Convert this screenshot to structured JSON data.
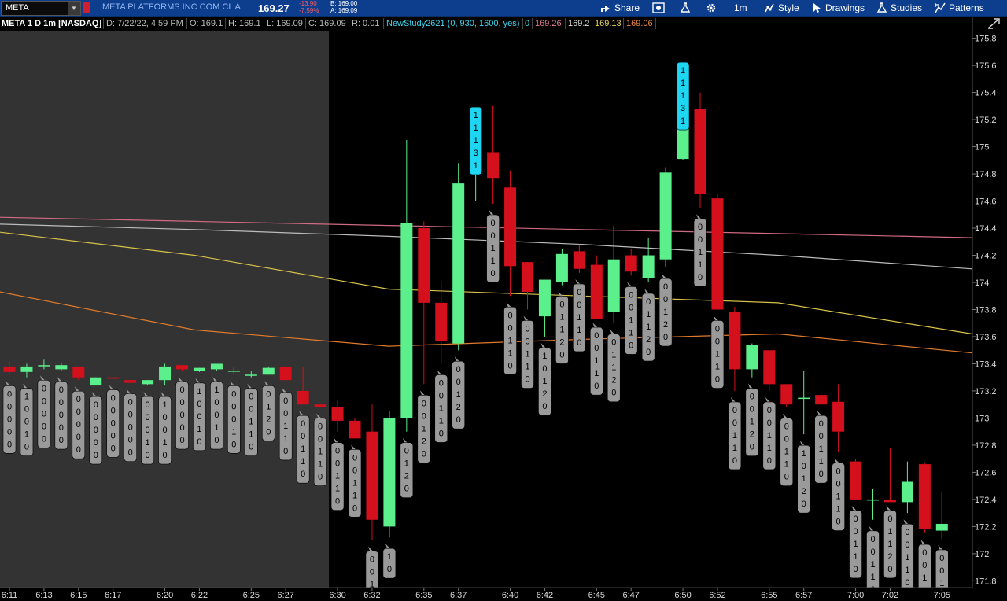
{
  "toolbar": {
    "symbol": "META",
    "company": "META PLATFORMS INC COM CL A",
    "last": "169.27",
    "change": "-13.90",
    "change_pct": "-7.59%",
    "bid": "B: 169.00",
    "ask": "A: 169.09",
    "share_label": "Share",
    "timeframe_label": "1m",
    "style_label": "Style",
    "drawings_label": "Drawings",
    "studies_label": "Studies",
    "patterns_label": "Patterns"
  },
  "infobar": {
    "title": "META 1 D 1m [NASDAQ]",
    "date": "D: 7/22/22, 4:59 PM",
    "open": "O: 169.1",
    "high": "H: 169.1",
    "low": "L: 169.09",
    "close": "C: 169.09",
    "range": "R: 0.01",
    "study": "NewStudy2621 (0, 930, 1600, yes)",
    "study_value": "0",
    "ma1": "169.26",
    "ma2": "169.2",
    "ma3": "169.13",
    "ma4": "169.06"
  },
  "colors": {
    "up": "#5cf08c",
    "down": "#d4101c",
    "extended_bg": "#333333",
    "label_grey": "#9a9a9a",
    "label_cyan": "#1ed6f2",
    "ma_pink": "#d06a82",
    "ma_white": "#bcbcbc",
    "ma_yellow": "#d8c34a",
    "ma_orange": "#e07a2c"
  },
  "chart_data": {
    "type": "candlestick",
    "ylim": [
      171.75,
      175.85
    ],
    "y_ticks": [
      "175.8",
      "175.6",
      "175.4",
      "175.2",
      "175",
      "174.8",
      "174.6",
      "174.4",
      "174.2",
      "174",
      "173.8",
      "173.6",
      "173.4",
      "173.2",
      "173",
      "172.8",
      "172.6",
      "172.4",
      "172.2",
      "172",
      "171.8"
    ],
    "x_ticks": [
      "6:11",
      "6:13",
      "6:15",
      "6:17",
      "6:20",
      "6:22",
      "6:25",
      "6:27",
      "6:30",
      "6:32",
      "6:35",
      "6:37",
      "6:40",
      "6:42",
      "6:45",
      "6:47",
      "6:50",
      "6:52",
      "6:55",
      "6:57",
      "7:00",
      "7:02",
      "7:05"
    ],
    "candles": [
      {
        "o": 173.38,
        "h": 173.42,
        "l": 173.32,
        "c": 173.34
      },
      {
        "o": 173.34,
        "h": 173.4,
        "l": 173.3,
        "c": 173.38
      },
      {
        "o": 173.39,
        "h": 173.43,
        "l": 173.36,
        "c": 173.39
      },
      {
        "o": 173.36,
        "h": 173.41,
        "l": 173.35,
        "c": 173.39
      },
      {
        "o": 173.38,
        "h": 173.38,
        "l": 173.28,
        "c": 173.3
      },
      {
        "o": 173.24,
        "h": 173.3,
        "l": 173.24,
        "c": 173.3
      },
      {
        "o": 173.3,
        "h": 173.3,
        "l": 173.29,
        "c": 173.29
      },
      {
        "o": 173.28,
        "h": 173.28,
        "l": 173.26,
        "c": 173.26
      },
      {
        "o": 173.25,
        "h": 173.28,
        "l": 173.24,
        "c": 173.28
      },
      {
        "o": 173.28,
        "h": 173.4,
        "l": 173.24,
        "c": 173.38
      },
      {
        "o": 173.39,
        "h": 173.39,
        "l": 173.35,
        "c": 173.36
      },
      {
        "o": 173.35,
        "h": 173.37,
        "l": 173.34,
        "c": 173.37
      },
      {
        "o": 173.36,
        "h": 173.4,
        "l": 173.35,
        "c": 173.4
      },
      {
        "o": 173.35,
        "h": 173.38,
        "l": 173.32,
        "c": 173.35
      },
      {
        "o": 173.32,
        "h": 173.35,
        "l": 173.3,
        "c": 173.32
      },
      {
        "o": 173.32,
        "h": 173.38,
        "l": 173.32,
        "c": 173.37
      },
      {
        "o": 173.38,
        "h": 173.38,
        "l": 173.27,
        "c": 173.28
      },
      {
        "o": 173.2,
        "h": 173.38,
        "l": 173.1,
        "c": 173.1
      },
      {
        "o": 173.1,
        "h": 173.1,
        "l": 173.08,
        "c": 173.08
      },
      {
        "o": 173.08,
        "h": 173.13,
        "l": 172.9,
        "c": 172.98
      },
      {
        "o": 172.98,
        "h": 173.0,
        "l": 172.85,
        "c": 172.85
      },
      {
        "o": 172.9,
        "h": 173.1,
        "l": 172.1,
        "c": 172.25
      },
      {
        "o": 172.2,
        "h": 173.05,
        "l": 172.12,
        "c": 173.0
      },
      {
        "o": 173.0,
        "h": 175.05,
        "l": 172.9,
        "c": 174.44
      },
      {
        "o": 174.4,
        "h": 174.45,
        "l": 173.25,
        "c": 173.85
      },
      {
        "o": 173.85,
        "h": 174.0,
        "l": 173.4,
        "c": 173.57
      },
      {
        "o": 173.55,
        "h": 174.88,
        "l": 173.5,
        "c": 174.73
      },
      {
        "o": 174.8,
        "h": 175.27,
        "l": 174.6,
        "c": 174.95
      },
      {
        "o": 174.96,
        "h": 175.3,
        "l": 174.58,
        "c": 174.77
      },
      {
        "o": 174.7,
        "h": 174.82,
        "l": 173.9,
        "c": 174.12
      },
      {
        "o": 174.15,
        "h": 174.15,
        "l": 173.8,
        "c": 173.93
      },
      {
        "o": 173.75,
        "h": 174.02,
        "l": 173.6,
        "c": 174.02
      },
      {
        "o": 174.0,
        "h": 174.25,
        "l": 173.98,
        "c": 174.21
      },
      {
        "o": 174.23,
        "h": 174.28,
        "l": 174.07,
        "c": 174.1
      },
      {
        "o": 174.13,
        "h": 174.2,
        "l": 173.75,
        "c": 173.73
      },
      {
        "o": 173.78,
        "h": 174.42,
        "l": 173.7,
        "c": 174.17
      },
      {
        "o": 174.2,
        "h": 174.25,
        "l": 174.05,
        "c": 174.08
      },
      {
        "o": 174.03,
        "h": 174.33,
        "l": 174.0,
        "c": 174.2
      },
      {
        "o": 174.17,
        "h": 174.85,
        "l": 174.11,
        "c": 174.81
      },
      {
        "o": 174.91,
        "h": 175.6,
        "l": 174.9,
        "c": 175.22
      },
      {
        "o": 175.28,
        "h": 175.4,
        "l": 174.55,
        "c": 174.65
      },
      {
        "o": 174.62,
        "h": 174.65,
        "l": 173.8,
        "c": 173.8
      },
      {
        "o": 173.78,
        "h": 173.82,
        "l": 173.2,
        "c": 173.36
      },
      {
        "o": 173.36,
        "h": 173.55,
        "l": 173.3,
        "c": 173.54
      },
      {
        "o": 173.5,
        "h": 173.5,
        "l": 173.2,
        "c": 173.25
      },
      {
        "o": 173.25,
        "h": 173.25,
        "l": 173.08,
        "c": 173.1
      },
      {
        "o": 173.15,
        "h": 173.35,
        "l": 172.88,
        "c": 173.15
      },
      {
        "o": 173.17,
        "h": 173.2,
        "l": 173.1,
        "c": 173.1
      },
      {
        "o": 173.12,
        "h": 173.25,
        "l": 172.75,
        "c": 172.9
      },
      {
        "o": 172.68,
        "h": 172.7,
        "l": 172.4,
        "c": 172.4
      },
      {
        "o": 172.4,
        "h": 172.48,
        "l": 172.25,
        "c": 172.4
      },
      {
        "o": 172.4,
        "h": 172.78,
        "l": 172.4,
        "c": 172.38
      },
      {
        "o": 172.38,
        "h": 172.68,
        "l": 172.3,
        "c": 172.53
      },
      {
        "o": 172.66,
        "h": 172.67,
        "l": 172.15,
        "c": 172.18
      },
      {
        "o": 172.17,
        "h": 172.45,
        "l": 172.11,
        "c": 172.22
      }
    ],
    "labels": [
      [
        "0",
        "0",
        "0",
        "0",
        "0"
      ],
      [
        "1",
        "0",
        "0",
        "1",
        "0"
      ],
      [
        "0",
        "0",
        "0",
        "0",
        "0"
      ],
      [
        "0",
        "0",
        "0",
        "0",
        "0"
      ],
      [
        "0",
        "0",
        "0",
        "0",
        "0"
      ],
      [
        "0",
        "0",
        "0",
        "0",
        "0"
      ],
      [
        "0",
        "0",
        "0",
        "0",
        "0"
      ],
      [
        "0",
        "0",
        "0",
        "0",
        "0"
      ],
      [
        "0",
        "0",
        "0",
        "1",
        "0"
      ],
      [
        "1",
        "0",
        "0",
        "1",
        "0"
      ],
      [
        "0",
        "0",
        "0",
        "0",
        "0"
      ],
      [
        "1",
        "0",
        "0",
        "1",
        "0"
      ],
      [
        "1",
        "0",
        "0",
        "1",
        "0"
      ],
      [
        "0",
        "0",
        "0",
        "1",
        "0"
      ],
      [
        "0",
        "0",
        "1",
        "1",
        "0"
      ],
      [
        "0",
        "1",
        "2",
        "0",
        ""
      ],
      [
        "0",
        "0",
        "1",
        "1",
        "0"
      ],
      [
        "0",
        "0",
        "1",
        "1",
        "0"
      ],
      [
        "0",
        "0",
        "1",
        "1",
        "0"
      ],
      [
        "0",
        "0",
        "1",
        "1",
        "0"
      ],
      [
        "0",
        "0",
        "1",
        "1",
        "0"
      ],
      [
        "0",
        "0",
        "1",
        ""
      ],
      [
        "1",
        "0",
        ""
      ],
      [
        "0",
        "1",
        "2",
        "0"
      ],
      [
        "0",
        "0",
        "1",
        "2",
        "0"
      ],
      [
        "0",
        "0",
        "1",
        "1",
        "0"
      ],
      [
        "0",
        "0",
        "1",
        "2",
        "0"
      ],
      [
        "1",
        "1",
        "1",
        "3",
        "1"
      ],
      [
        "0",
        "0",
        "1",
        "1",
        "0"
      ],
      [
        "0",
        "0",
        "1",
        "1",
        "0"
      ],
      [
        "0",
        "0",
        "1",
        "1",
        "0"
      ],
      [
        "1",
        "0",
        "1",
        "2",
        "0"
      ],
      [
        "0",
        "1",
        "1",
        "2",
        "0"
      ],
      [
        "0",
        "0",
        "1",
        "1",
        "0"
      ],
      [
        "0",
        "0",
        "1",
        "1",
        "0"
      ],
      [
        "0",
        "1",
        "1",
        "2",
        "0"
      ],
      [
        "0",
        "0",
        "1",
        "1",
        "0"
      ],
      [
        "0",
        "1",
        "1",
        "2",
        "0"
      ],
      [
        "0",
        "0",
        "1",
        "2",
        "0"
      ],
      [
        "1",
        "1",
        "1",
        "3",
        "1"
      ],
      [
        "0",
        "0",
        "1",
        "1",
        "0"
      ],
      [
        "0",
        "0",
        "1",
        "1",
        "0"
      ],
      [
        "0",
        "0",
        "1",
        "1",
        "0"
      ],
      [
        "0",
        "0",
        "1",
        "2",
        "0"
      ],
      [
        "0",
        "0",
        "1",
        "1",
        "0"
      ],
      [
        "0",
        "0",
        "1",
        "1",
        "0"
      ],
      [
        "1",
        "0",
        "1",
        "2",
        "0"
      ],
      [
        "0",
        "0",
        "1",
        "1",
        "0"
      ],
      [
        "0",
        "0",
        "1",
        "1",
        "0"
      ],
      [
        "0",
        "0",
        "1",
        "1",
        "0"
      ],
      [
        "0",
        "0",
        "1",
        "1",
        "0"
      ],
      [
        "0",
        "1",
        "1",
        "2",
        "0"
      ],
      [
        "0",
        "0",
        "1",
        "1",
        "0"
      ],
      [
        "0",
        "0",
        "1",
        "2",
        "0"
      ],
      [
        "0",
        "0",
        "1",
        "1",
        "0"
      ]
    ],
    "label_highlight": [
      27,
      39
    ],
    "moving_averages": [
      {
        "color_key": "ma_pink",
        "points": [
          174.48,
          174.45,
          174.42,
          174.39,
          174.36,
          174.33
        ]
      },
      {
        "color_key": "ma_white",
        "points": [
          174.43,
          174.39,
          174.34,
          174.28,
          174.2,
          174.1
        ]
      },
      {
        "color_key": "ma_yellow",
        "points": [
          174.37,
          174.2,
          173.95,
          173.9,
          173.85,
          173.62
        ]
      },
      {
        "color_key": "ma_orange",
        "points": [
          173.93,
          173.65,
          173.53,
          173.58,
          173.62,
          173.48
        ]
      }
    ]
  }
}
